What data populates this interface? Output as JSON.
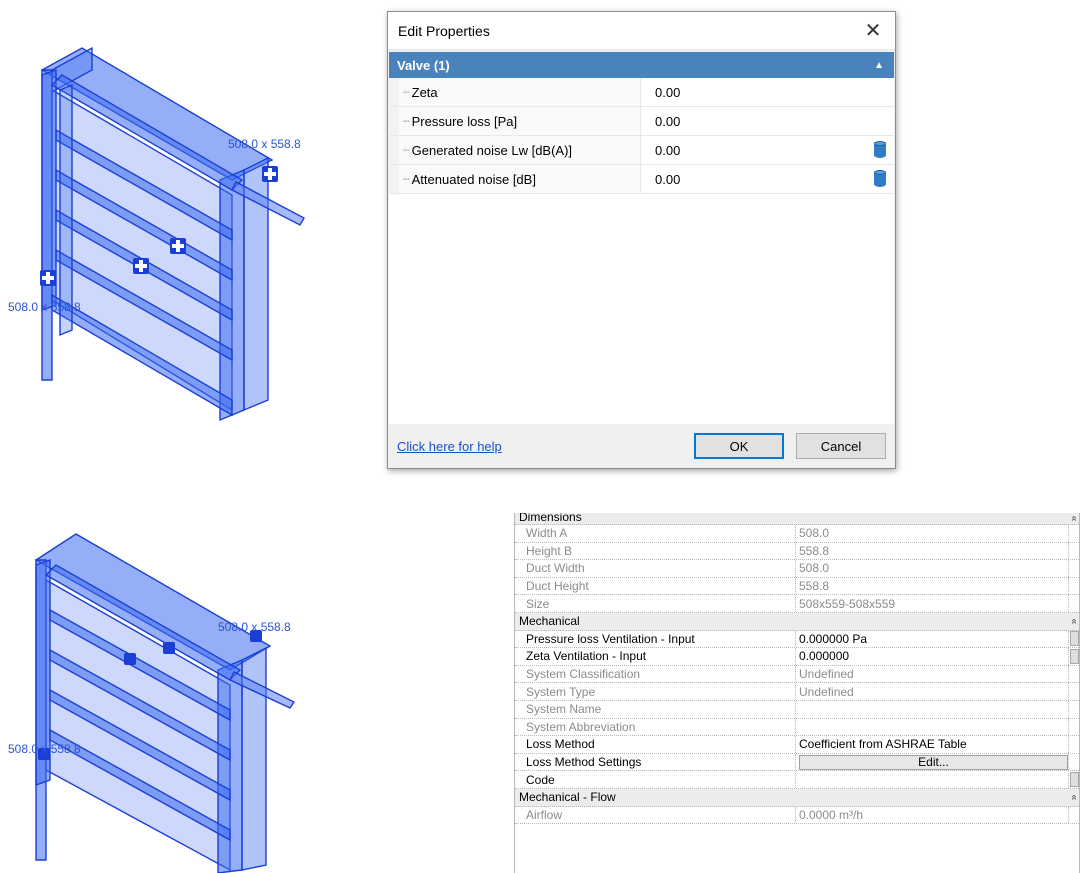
{
  "viewport_top": {
    "label_right": "508.0 x 558.8",
    "label_left": "508.0 x 558.8"
  },
  "viewport_bottom": {
    "label_right": "508.0 x 558.8",
    "label_left": "508.0 x 558.8"
  },
  "dialog": {
    "title": "Edit Properties",
    "close_glyph": "✕",
    "group_label": "Valve (1)",
    "group_toggle": "▲",
    "rows": [
      {
        "name": "Zeta",
        "value": "0.00",
        "has_db_icon": false
      },
      {
        "name": "Pressure loss [Pa]",
        "value": "0.00",
        "has_db_icon": false
      },
      {
        "name": "Generated noise Lw [dB(A)]",
        "value": "0.00",
        "has_db_icon": true
      },
      {
        "name": "Attenuated noise [dB]",
        "value": "0.00",
        "has_db_icon": true
      }
    ],
    "help_link": "Click here for help",
    "ok_label": "OK",
    "cancel_label": "Cancel"
  },
  "properties_panel": {
    "dimensions_group": "Dimensions",
    "collapse_glyph": "»",
    "width_a": {
      "label": "Width A",
      "value": "508.0"
    },
    "height_b": {
      "label": "Height B",
      "value": "558.8"
    },
    "duct_width": {
      "label": "Duct Width",
      "value": "508.0"
    },
    "duct_height": {
      "label": "Duct Height",
      "value": "558.8"
    },
    "size": {
      "label": "Size",
      "value": "508x559-508x559"
    },
    "mechanical_group": "Mechanical",
    "pressure_loss": {
      "label": "Pressure loss Ventilation - Input",
      "value": "0.000000 Pa"
    },
    "zeta_vent": {
      "label": "Zeta Ventilation - Input",
      "value": "0.000000"
    },
    "system_classification": {
      "label": "System Classification",
      "value": "Undefined"
    },
    "system_type": {
      "label": "System Type",
      "value": "Undefined"
    },
    "system_name": {
      "label": "System Name",
      "value": ""
    },
    "system_abbreviation": {
      "label": "System Abbreviation",
      "value": ""
    },
    "loss_method": {
      "label": "Loss Method",
      "value": "Coefficient from ASHRAE Table"
    },
    "loss_method_settings": {
      "label": "Loss Method Settings",
      "button": "Edit..."
    },
    "code": {
      "label": "Code",
      "value": ""
    },
    "mechanical_flow_group": "Mechanical - Flow",
    "airflow": {
      "label": "Airflow",
      "value": "0.0000 m³/h"
    }
  }
}
